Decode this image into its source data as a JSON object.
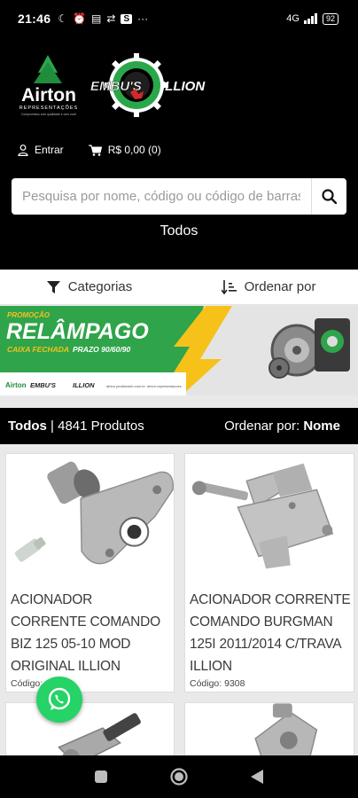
{
  "status_bar": {
    "time": "21:46",
    "notification_box": "S",
    "more": "···",
    "network": "4G",
    "battery": "92"
  },
  "header": {
    "brand_airton": "Airton",
    "brand_airton_sub": "REPRESENTAÇÕES",
    "brand_airton_tagline": "Compromisso com qualidade e com você",
    "brand_embus": "EMBU'S",
    "brand_illion": "ILLION",
    "login_label": "Entrar",
    "cart_label": "R$ 0,00 (0)",
    "search_placeholder": "Pesquisa por nome, código ou código de barras",
    "category_label": "Todos"
  },
  "filters": {
    "categories_label": "Categorias",
    "sort_label": "Ordenar por"
  },
  "banner": {
    "promo_label": "PROMOÇÃO",
    "headline": "RELÂMPAGO",
    "subline_1": "CAIXA FECHADA",
    "subline_2": "PRAZO 90/60/90",
    "footer_airton": "Airton",
    "footer_embus": "EMBU'S",
    "footer_illion": "ILLION",
    "footer_site": "airton.pedidoweb.com.br",
    "footer_insta": "airton.representacoes"
  },
  "results": {
    "category": "Todos",
    "separator": " | ",
    "count": "4841 Produtos",
    "sort_prefix": "Ordenar por: ",
    "sort_value": "Nome"
  },
  "products": [
    {
      "name": "ACIONADOR CORRENTE COMANDO BIZ 125 05-10 MOD ORIGINAL ILLION",
      "code": "Código: 9306"
    },
    {
      "name": "ACIONADOR CORRENTE COMANDO BURGMAN 125i 2011/2014 C/TRAVA ILLION",
      "code": "Código: 9308"
    }
  ],
  "colors": {
    "accent_green": "#2aa74a",
    "whatsapp": "#25d366",
    "banner_yellow": "#f6c21a"
  },
  "icons": {
    "user": "user-icon",
    "cart": "cart-icon",
    "search": "search-icon",
    "filter": "filter-icon",
    "sort": "sort-icon",
    "whatsapp": "whatsapp-icon",
    "nav_recent": "recent-apps-icon",
    "nav_home": "home-icon",
    "nav_back": "back-icon"
  }
}
